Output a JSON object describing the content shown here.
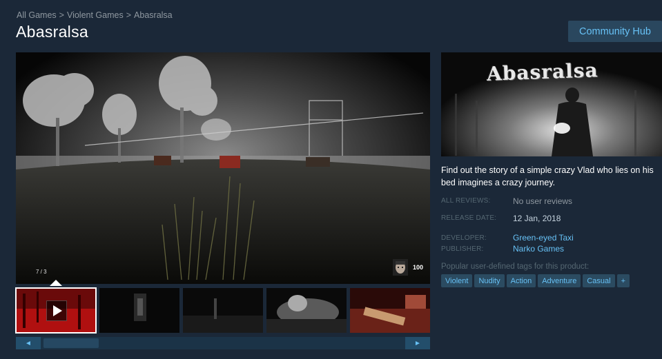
{
  "breadcrumb": [
    "All Games",
    "Violent Games",
    "Abasralsa"
  ],
  "breadcrumb_separator": ">",
  "title": "Abasralsa",
  "community_hub_label": "Community Hub",
  "media": {
    "counter": "7 / 3",
    "hud_value": "100"
  },
  "capsule_title": "Abasralsa",
  "description": "Find out the story of a simple crazy Vlad who lies on his bed imagines a crazy journey.",
  "info": {
    "reviews_label": "ALL REVIEWS:",
    "reviews_value": "No user reviews",
    "release_label": "RELEASE DATE:",
    "release_value": "12 Jan, 2018",
    "developer_label": "DEVELOPER:",
    "developer_value": "Green-eyed Taxi",
    "publisher_label": "PUBLISHER:",
    "publisher_value": "Narko Games"
  },
  "tags_label": "Popular user-defined tags for this product:",
  "tags": [
    "Violent",
    "Nudity",
    "Action",
    "Adventure",
    "Casual",
    "+"
  ],
  "scroll": {
    "left_arrow": "◄",
    "right_arrow": "►"
  },
  "colors": {
    "background": "#1b2838",
    "link": "#67c1f5",
    "button_bg": "#2a475e"
  }
}
